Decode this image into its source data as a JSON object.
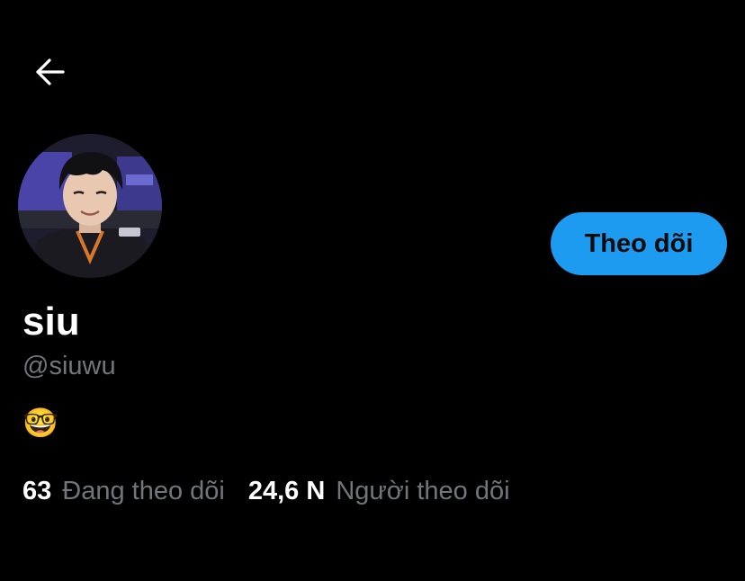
{
  "header": {
    "back_icon": "arrow-left-icon"
  },
  "profile": {
    "avatar_alt": "avatar",
    "display_name": "siu",
    "handle": "@siuwu",
    "bio": "🤓",
    "follow_button_label": "Theo dõi",
    "follow_button_color": "#1d9bf0"
  },
  "stats": {
    "following": {
      "count": "63",
      "label": "Đang theo dõi"
    },
    "followers": {
      "count": "24,6 N",
      "label": "Người theo dõi"
    }
  },
  "colors": {
    "background": "#000000",
    "text_primary": "#ffffff",
    "text_secondary": "#71767b",
    "accent": "#1d9bf0"
  }
}
